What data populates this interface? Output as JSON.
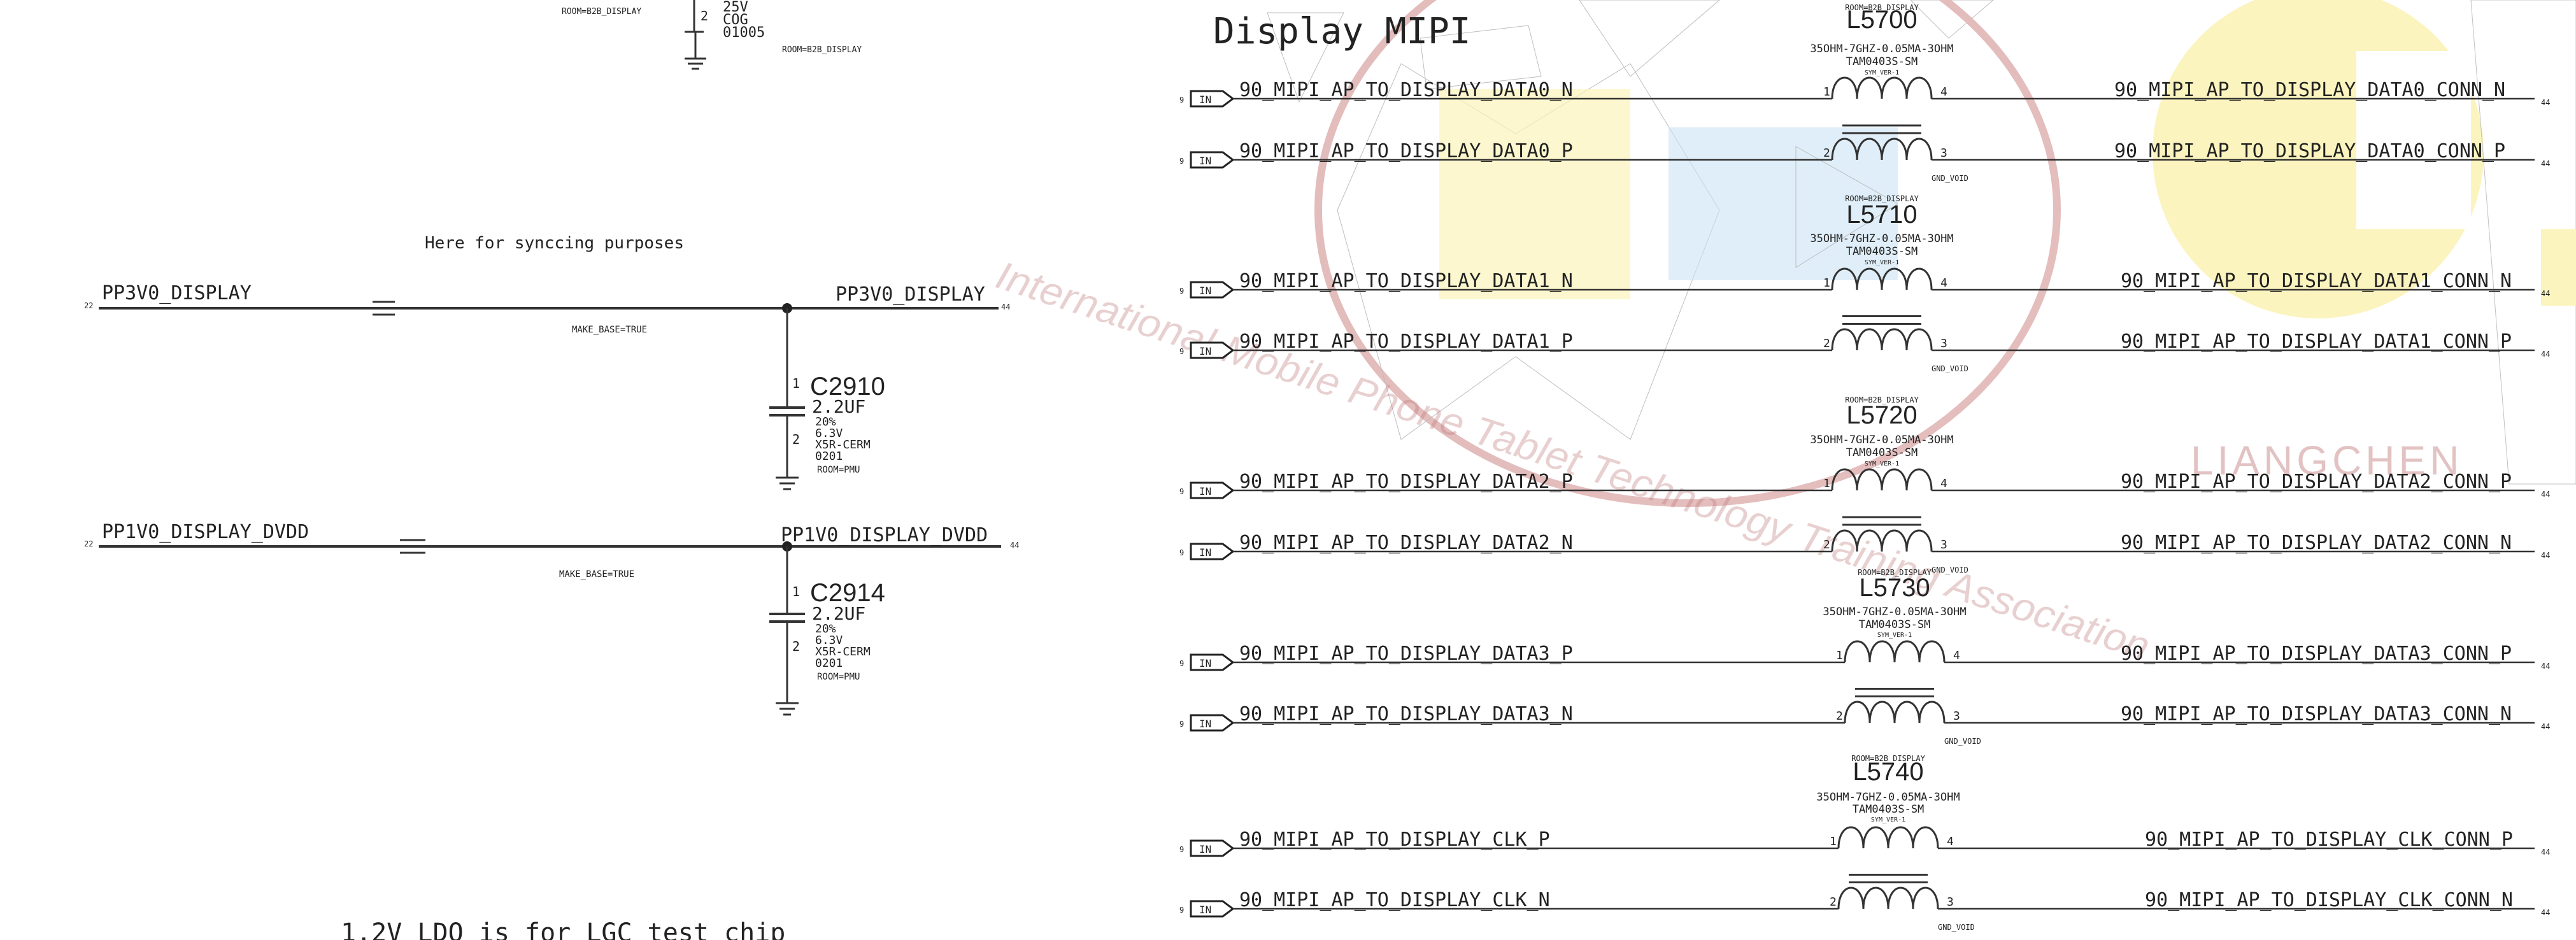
{
  "title": "Display MIPI",
  "left_panel": {
    "top_fragment": {
      "room_left": "ROOM=B2B_DISPLAY",
      "pin": "2",
      "specs": [
        "25V",
        "COG",
        "01005"
      ],
      "room_right": "ROOM=B2B_DISPLAY"
    },
    "sync_note": "Here for synccing purposes",
    "ldo_note": "1.2V LDO is for LGC test chip",
    "rails": [
      {
        "page_ref": "22",
        "left_net": "PP3V0_DISPLAY",
        "right_net": "PP3V0_DISPLAY",
        "right_ref": "44",
        "make_base": "MAKE_BASE=TRUE",
        "cap": {
          "ref": "C2910",
          "value": "2.2UF",
          "pin_top": "1",
          "pin_bottom": "2",
          "specs": [
            "20%",
            "6.3V",
            "X5R-CERM",
            "0201"
          ],
          "room": "ROOM=PMU"
        }
      },
      {
        "page_ref": "22",
        "left_net": "PP1V0_DISPLAY_DVDD",
        "right_net": "PP1V0_DISPLAY_DVDD",
        "right_ref": "44",
        "make_base": "MAKE_BASE=TRUE",
        "cap": {
          "ref": "C2914",
          "value": "2.2UF",
          "pin_top": "1",
          "pin_bottom": "2",
          "specs": [
            "20%",
            "6.3V",
            "X5R-CERM",
            "0201"
          ],
          "room": "ROOM=PMU"
        }
      }
    ]
  },
  "filters": [
    {
      "ref": "L5700",
      "room": "ROOM=B2B_DISPLAY",
      "spec": "35OHM-7GHZ-0.05MA-3OHM",
      "package": "TAM0403S-SM",
      "sym": "SYM_VER-1",
      "gnd_void": "GND_VOID",
      "top": {
        "page_ref": "9",
        "in_label": "IN",
        "net": "90_MIPI_AP_TO_DISPLAY_DATA0_N",
        "pin_in": "1",
        "pin_out": "4",
        "conn_net": "90_MIPI_AP_TO_DISPLAY_DATA0_CONN_N",
        "conn_ref": "44"
      },
      "bottom": {
        "page_ref": "9",
        "in_label": "IN",
        "net": "90_MIPI_AP_TO_DISPLAY_DATA0_P",
        "pin_in": "2",
        "pin_out": "3",
        "conn_net": "90_MIPI_AP_TO_DISPLAY_DATA0_CONN_P",
        "conn_ref": "44"
      }
    },
    {
      "ref": "L5710",
      "room": "ROOM=B2B_DISPLAY",
      "spec": "35OHM-7GHZ-0.05MA-3OHM",
      "package": "TAM0403S-SM",
      "sym": "SYM_VER-1",
      "gnd_void": "GND_VOID",
      "top": {
        "page_ref": "9",
        "in_label": "IN",
        "net": "90_MIPI_AP_TO_DISPLAY_DATA1_N",
        "pin_in": "1",
        "pin_out": "4",
        "conn_net": "90_MIPI_AP_TO_DISPLAY_DATA1_CONN_N",
        "conn_ref": "44"
      },
      "bottom": {
        "page_ref": "9",
        "in_label": "IN",
        "net": "90_MIPI_AP_TO_DISPLAY_DATA1_P",
        "pin_in": "2",
        "pin_out": "3",
        "conn_net": "90_MIPI_AP_TO_DISPLAY_DATA1_CONN_P",
        "conn_ref": "44"
      }
    },
    {
      "ref": "L5720",
      "room": "ROOM=B2B_DISPLAY",
      "spec": "35OHM-7GHZ-0.05MA-3OHM",
      "package": "TAM0403S-SM",
      "sym": "SYM_VER-1",
      "gnd_void": "GND_VOID",
      "top": {
        "page_ref": "9",
        "in_label": "IN",
        "net": "90_MIPI_AP_TO_DISPLAY_DATA2_P",
        "pin_in": "1",
        "pin_out": "4",
        "conn_net": "90_MIPI_AP_TO_DISPLAY_DATA2_CONN_P",
        "conn_ref": "44"
      },
      "bottom": {
        "page_ref": "9",
        "in_label": "IN",
        "net": "90_MIPI_AP_TO_DISPLAY_DATA2_N",
        "pin_in": "2",
        "pin_out": "3",
        "conn_net": "90_MIPI_AP_TO_DISPLAY_DATA2_CONN_N",
        "conn_ref": "44"
      }
    },
    {
      "ref": "L5730",
      "room": "ROOM=B2B_DISPLAY",
      "spec": "35OHM-7GHZ-0.05MA-3OHM",
      "package": "TAM0403S-SM",
      "sym": "SYM_VER-1",
      "gnd_void": "GND_VOID",
      "top": {
        "page_ref": "9",
        "in_label": "IN",
        "net": "90_MIPI_AP_TO_DISPLAY_DATA3_P",
        "pin_in": "1",
        "pin_out": "4",
        "conn_net": "90_MIPI_AP_TO_DISPLAY_DATA3_CONN_P",
        "conn_ref": "44"
      },
      "bottom": {
        "page_ref": "9",
        "in_label": "IN",
        "net": "90_MIPI_AP_TO_DISPLAY_DATA3_N",
        "pin_in": "2",
        "pin_out": "3",
        "conn_net": "90_MIPI_AP_TO_DISPLAY_DATA3_CONN_N",
        "conn_ref": "44"
      }
    },
    {
      "ref": "L5740",
      "room": "ROOM=B2B_DISPLAY",
      "spec": "35OHM-7GHZ-0.05MA-3OHM",
      "package": "TAM0403S-SM",
      "sym": "SYM_VER-1",
      "gnd_void": "GND_VOID",
      "top": {
        "page_ref": "9",
        "in_label": "IN",
        "net": "90_MIPI_AP_TO_DISPLAY_CLK_P",
        "pin_in": "1",
        "pin_out": "4",
        "conn_net": "90_MIPI_AP_TO_DISPLAY_CLK_CONN_P",
        "conn_ref": "44"
      },
      "bottom": {
        "page_ref": "9",
        "in_label": "IN",
        "net": "90_MIPI_AP_TO_DISPLAY_CLK_N",
        "pin_in": "2",
        "pin_out": "3",
        "conn_net": "90_MIPI_AP_TO_DISPLAY_CLK_CONN_N",
        "conn_ref": "44"
      }
    }
  ],
  "watermark": {
    "arc_text": "International Mobile Phone Tablet Technology Training Association",
    "brand": "LIANGCHEN",
    "colors": {
      "red": "#c03a3a",
      "yellow": "#f2dc2a",
      "blue": "#5aa8d8",
      "gray": "#999999"
    }
  }
}
